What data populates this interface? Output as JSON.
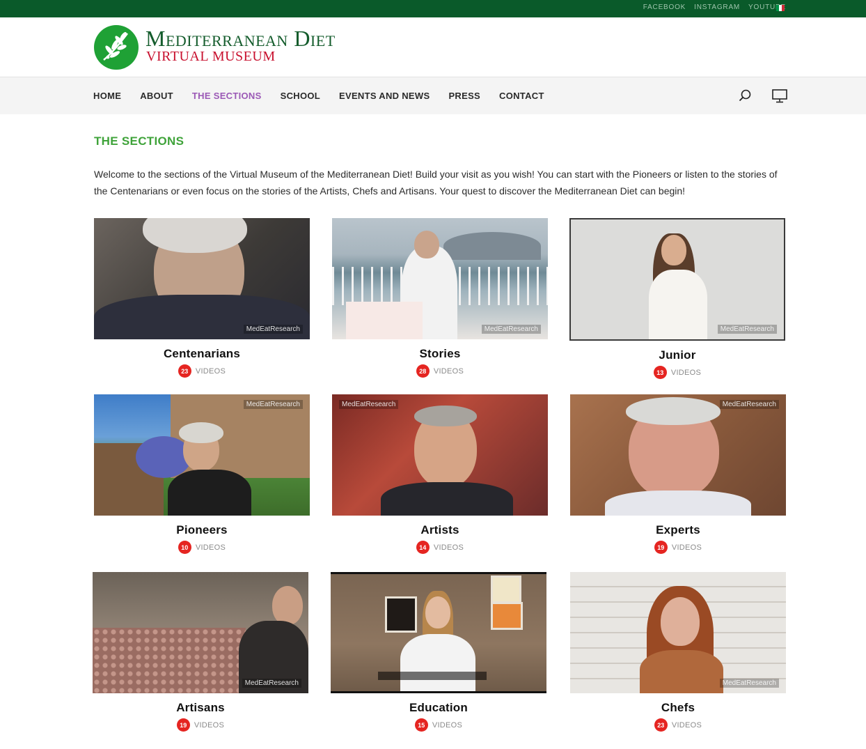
{
  "topbar": {
    "social": [
      "FACEBOOK",
      "INSTAGRAM",
      "YOUTUBE"
    ],
    "flag_colors": [
      "#009246",
      "#ffffff",
      "#ce2b37"
    ]
  },
  "header": {
    "logo_line1": "Mediterranean Diet",
    "logo_line2": "VIRTUAL MUSEUM"
  },
  "nav": {
    "items": [
      "HOME",
      "ABOUT",
      "THE SECTIONS",
      "SCHOOL",
      "EVENTS AND NEWS",
      "PRESS",
      "CONTACT"
    ],
    "active": "THE SECTIONS",
    "icons": [
      "search-icon",
      "screen-icon"
    ]
  },
  "main": {
    "title": "THE SECTIONS",
    "intro": "Welcome to the sections of the Virtual Museum of the Mediterranean Diet! Build your visit as you wish! You can start with the Pioneers or listen to the stories of the Centenarians or even focus on the stories of the Artists, Chefs and Artisans. Your quest to discover the Mediterranean Diet can begin!",
    "videos_label": "VIDEOS",
    "watermark": "MedEatResearch",
    "sections": [
      {
        "name": "Centenarians",
        "count": "23"
      },
      {
        "name": "Stories",
        "count": "28"
      },
      {
        "name": "Junior",
        "count": "13"
      },
      {
        "name": "Pioneers",
        "count": "10"
      },
      {
        "name": "Artists",
        "count": "14"
      },
      {
        "name": "Experts",
        "count": "19"
      },
      {
        "name": "Artisans",
        "count": "19"
      },
      {
        "name": "Education",
        "count": "15"
      },
      {
        "name": "Chefs",
        "count": "23"
      }
    ]
  },
  "colors": {
    "topbar": "#0a5a2a",
    "accent_green": "#3fa33a",
    "nav_active": "#9b59b6",
    "badge_red": "#e52521"
  }
}
